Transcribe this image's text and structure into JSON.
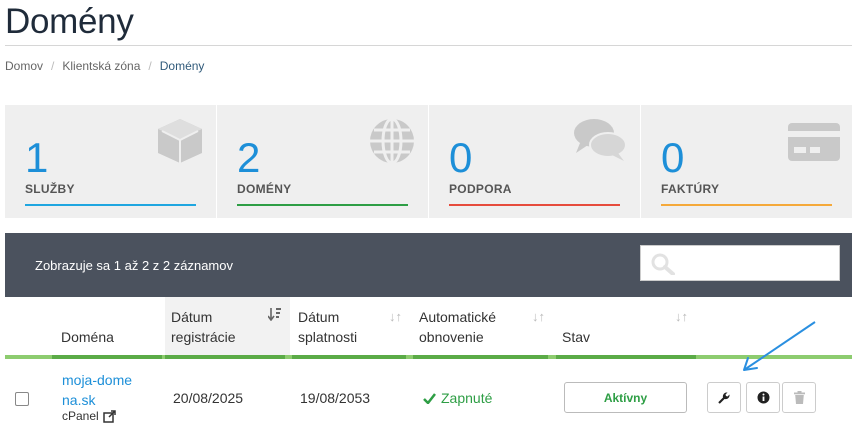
{
  "page": {
    "title": "Domény"
  },
  "breadcrumb": {
    "items": [
      "Domov",
      "Klientská zóna",
      "Domény"
    ]
  },
  "stats": [
    {
      "value": "1",
      "label": "SLUŽBY",
      "color": "#1fa6e0",
      "icon": "cube-icon"
    },
    {
      "value": "2",
      "label": "DOMÉNY",
      "color": "#2e9e45",
      "icon": "globe-icon"
    },
    {
      "value": "0",
      "label": "PODPORA",
      "color": "#e64c3c",
      "icon": "comments-icon"
    },
    {
      "value": "0",
      "label": "FAKTÚRY",
      "color": "#f5a93a",
      "icon": "credit-card-icon"
    }
  ],
  "table": {
    "info": "Zobrazuje sa 1 až 2 z 2 záznamov",
    "search_placeholder": "",
    "columns": [
      "Doména",
      "Dátum registrácie",
      "Dátum splatnosti",
      "Automatické obnovenie",
      "Stav"
    ],
    "rows": [
      {
        "domain": "moja-domena.sk",
        "cpanel": "cPanel",
        "registered": "20/08/2025",
        "due": "19/08/2053",
        "autorenew": "Zapnuté",
        "status": "Aktívny"
      }
    ]
  },
  "colors": {
    "accent": "#1d8fd8",
    "header": "#4b525e",
    "success": "#2e9e45"
  }
}
